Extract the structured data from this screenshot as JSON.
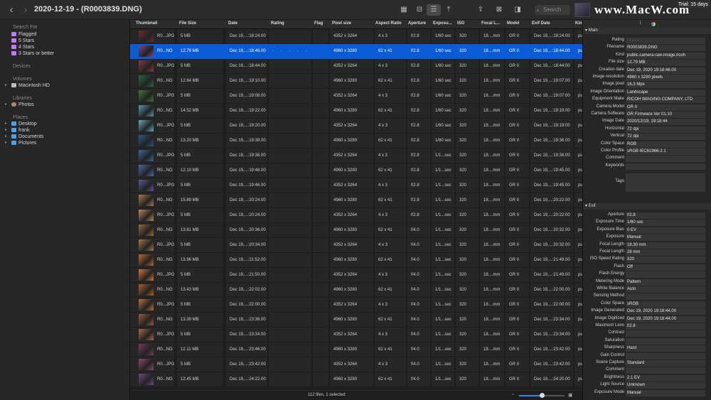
{
  "window": {
    "title": "2020-12-19 - (R0003839.DNG)",
    "trial_badge": "Trial: 15 days",
    "watermark": "www.MacW.com",
    "search_placeholder": "Search"
  },
  "toolbar": {
    "buttons": [
      "grid-view-icon",
      "split-view-icon",
      "list-view-icon",
      "export-icon",
      "share-icon",
      "trash-icon",
      "tag-icon"
    ]
  },
  "sidebar": {
    "search_for_header": "Search For",
    "search_items": [
      {
        "label": "Flagged",
        "icon": "folder-icon"
      },
      {
        "label": "5 Stars",
        "icon": "folder-icon"
      },
      {
        "label": "4 Stars",
        "icon": "folder-icon"
      },
      {
        "label": "3 Stars or better",
        "icon": "folder-icon"
      }
    ],
    "devices_header": "Devices",
    "volumes_header": "Volumes",
    "volumes": [
      {
        "label": "Macintosh HD",
        "icon": "disk-icon"
      }
    ],
    "libraries_header": "Libraries",
    "libraries": [
      {
        "label": "Photos",
        "icon": "photos-icon"
      }
    ],
    "places_header": "Places",
    "places": [
      {
        "label": "Desktop",
        "icon": "folder-icon"
      },
      {
        "label": "frank",
        "icon": "folder-icon"
      },
      {
        "label": "Documents",
        "icon": "folder-icon"
      },
      {
        "label": "Pictures",
        "icon": "folder-icon"
      }
    ]
  },
  "table": {
    "columns": [
      "Thumbnail",
      "File Size",
      "Date",
      "Rating",
      "Flag",
      "Pixel size",
      "Aspect Ratio",
      "Aperture",
      "Exposu...",
      "ISO",
      "Focal L...",
      "Model",
      "Exif Date",
      "Kin"
    ],
    "rows": [
      {
        "name": "R0...JPG",
        "size": "5 MB",
        "date": "Dec 19,...:18:24.00",
        "rating": "",
        "pixel": "4352 x 3264",
        "aspect": "4 x 3",
        "ap": "f/2.8",
        "exp": "1/60 sec",
        "iso": "320",
        "focal": "18....mm",
        "model": "GR II",
        "exif": "Dec 19,...:18:24:00",
        "kind": "pu",
        "thumb": "#6b2e2e"
      },
      {
        "name": "R0...NG",
        "size": "12.79 MB",
        "date": "Dec 19,...:18:46.00",
        "rating": "· · · · ·",
        "pixel": "4960 x 3280",
        "aspect": "62 x 41",
        "ap": "f/2.8",
        "exp": "1/60 sec",
        "iso": "320",
        "focal": "18....mm",
        "model": "GR II",
        "exif": "Dec 19,...:18:44.00",
        "kind": "pu",
        "thumb": "#7a4a8a"
      },
      {
        "name": "R0...JPG",
        "size": "5 MB",
        "date": "Dec 19,...:18:44.00",
        "rating": "",
        "pixel": "4352 x 3264",
        "aspect": "4 x 3",
        "ap": "f/2.8",
        "exp": "1/60 sec",
        "iso": "320",
        "focal": "18....mm",
        "model": "GR II",
        "exif": "Dec 19,...:18:44:00",
        "kind": "pu",
        "thumb": "#8a3a4a"
      },
      {
        "name": "R0...NG",
        "size": "12.64 MB",
        "date": "Dec 19,...:19:10.00",
        "rating": "",
        "pixel": "4960 x 3280",
        "aspect": "62 x 41",
        "ap": "f/2.8",
        "exp": "1/60 sec",
        "iso": "320",
        "focal": "18....mm",
        "model": "GR II",
        "exif": "Dec 19,...:19:07.00",
        "kind": "pu",
        "thumb": "#2a6a4a"
      },
      {
        "name": "R0...JPG",
        "size": "5 MB",
        "date": "Dec 19,...:19:08.00",
        "rating": "",
        "pixel": "4352 x 3264",
        "aspect": "4 x 3",
        "ap": "f/2.8",
        "exp": "1/60 sec",
        "iso": "320",
        "focal": "18....mm",
        "model": "GR II",
        "exif": "Dec 19,...:19:07:00",
        "kind": "pu",
        "thumb": "#3a7a3a"
      },
      {
        "name": "R0...NG",
        "size": "14.52 MB",
        "date": "Dec 19,...:19:22.00",
        "rating": "",
        "pixel": "4960 x 3280",
        "aspect": "62 x 41",
        "ap": "f/2.8",
        "exp": "1/60 sec",
        "iso": "320",
        "focal": "18....mm",
        "model": "GR II",
        "exif": "Dec 19,...:19:19.00",
        "kind": "pu",
        "thumb": "#5a9ab0"
      },
      {
        "name": "R0...JPG",
        "size": "5 MB",
        "date": "Dec 19,...:19:20.00",
        "rating": "",
        "pixel": "4352 x 3264",
        "aspect": "4 x 3",
        "ap": "f/2.8",
        "exp": "1/60 sec",
        "iso": "320",
        "focal": "18....mm",
        "model": "GR II",
        "exif": "Dec 19,...:19:19:00",
        "kind": "pu",
        "thumb": "#6aaac0"
      },
      {
        "name": "R0...NG",
        "size": "13.20 MB",
        "date": "Dec 19,...:19:38.00",
        "rating": "",
        "pixel": "4960 x 3280",
        "aspect": "62 x 41",
        "ap": "f/2.8",
        "exp": "1/60 sec",
        "iso": "320",
        "focal": "18....mm",
        "model": "GR II",
        "exif": "Dec 19,...:19:36.00",
        "kind": "pu",
        "thumb": "#2a5a8a"
      },
      {
        "name": "R0...JPG",
        "size": "5 MB",
        "date": "Dec 19,...:19:36.00",
        "rating": "",
        "pixel": "4352 x 3264",
        "aspect": "4 x 3",
        "ap": "f/2.8",
        "exp": "1/1...sec",
        "iso": "320",
        "focal": "18....mm",
        "model": "GR II",
        "exif": "Dec 19,...:19:36:00",
        "kind": "pu",
        "thumb": "#3a6a9a"
      },
      {
        "name": "R0...NG",
        "size": "12.10 MB",
        "date": "Dec 19,...:19:48.00",
        "rating": "",
        "pixel": "4960 x 3280",
        "aspect": "62 x 41",
        "ap": "f/2.8",
        "exp": "1/1...sec",
        "iso": "320",
        "focal": "18....mm",
        "model": "GR II",
        "exif": "Dec 19,...:19:45.00",
        "kind": "pu",
        "thumb": "#4a6aaa"
      },
      {
        "name": "R0...JPG",
        "size": "5 MB",
        "date": "Dec 19,...:19:46.00",
        "rating": "",
        "pixel": "4352 x 3264",
        "aspect": "4 x 3",
        "ap": "f/2.8",
        "exp": "1/1...sec",
        "iso": "320",
        "focal": "18....mm",
        "model": "GR II",
        "exif": "Dec 19,...:19:45:00",
        "kind": "pu",
        "thumb": "#5a5a9a"
      },
      {
        "name": "R0...NG",
        "size": "15.89 MB",
        "date": "Dec 19,...:20:24.00",
        "rating": "",
        "pixel": "4960 x 3280",
        "aspect": "62 x 41",
        "ap": "f/2.8",
        "exp": "1/1...sec",
        "iso": "320",
        "focal": "18....mm",
        "model": "GR II",
        "exif": "Dec 19,...:20:22.00",
        "kind": "pu",
        "thumb": "#b07a4a"
      },
      {
        "name": "R0...JPG",
        "size": "5 MB",
        "date": "Dec 19,...:20:24.00",
        "rating": "",
        "pixel": "4352 x 3264",
        "aspect": "4 x 3",
        "ap": "f/2.8",
        "exp": "1/1...sec",
        "iso": "320",
        "focal": "18....mm",
        "model": "GR II",
        "exif": "Dec 19,...:20:22:00",
        "kind": "pu",
        "thumb": "#c08a5a"
      },
      {
        "name": "R0...NG",
        "size": "13.81 MB",
        "date": "Dec 19,...:20:36.00",
        "rating": "",
        "pixel": "4960 x 3280",
        "aspect": "62 x 41",
        "ap": "f/4.0",
        "exp": "1/1...sec",
        "iso": "320",
        "focal": "18....mm",
        "model": "GR II",
        "exif": "Dec 19,...:20:32.00",
        "kind": "pu",
        "thumb": "#9a6a3a"
      },
      {
        "name": "R0...JPG",
        "size": "5 MB",
        "date": "Dec 19,...:20:34.00",
        "rating": "",
        "pixel": "4352 x 3264",
        "aspect": "4 x 3",
        "ap": "f/4.0",
        "exp": "1/1...sec",
        "iso": "320",
        "focal": "18....mm",
        "model": "GR II",
        "exif": "Dec 19,...:20:32:00",
        "kind": "pu",
        "thumb": "#aa7a4a"
      },
      {
        "name": "R0...NG",
        "size": "13.96 MB",
        "date": "Dec 19,...:21:52.00",
        "rating": "",
        "pixel": "4960 x 3280",
        "aspect": "62 x 41",
        "ap": "f/4.0",
        "exp": "1/1...sec",
        "iso": "320",
        "focal": "18....mm",
        "model": "GR II",
        "exif": "Dec 19,...:21:49.00",
        "kind": "pu",
        "thumb": "#c06a2a"
      },
      {
        "name": "R0...JPG",
        "size": "5 MB",
        "date": "Dec 19,...:21:50.00",
        "rating": "",
        "pixel": "4352 x 3264",
        "aspect": "4 x 3",
        "ap": "f/4.0",
        "exp": "1/1...sec",
        "iso": "320",
        "focal": "18....mm",
        "model": "GR II",
        "exif": "Dec 19,...:21:49:00",
        "kind": "pu",
        "thumb": "#d07a3a"
      },
      {
        "name": "R0...NG",
        "size": "13.43 MB",
        "date": "Dec 19,...:22:02.00",
        "rating": "",
        "pixel": "4960 x 3280",
        "aspect": "62 x 41",
        "ap": "f/4.0",
        "exp": "1/1...sec",
        "iso": "320",
        "focal": "18....mm",
        "model": "GR II",
        "exif": "Dec 19,...:22:00.00",
        "kind": "pu",
        "thumb": "#b0602a"
      },
      {
        "name": "R0...JPG",
        "size": "5 MB",
        "date": "Dec 19,...:22:00.00",
        "rating": "",
        "pixel": "4352 x 3264",
        "aspect": "4 x 3",
        "ap": "f/4.0",
        "exp": "1/1...sec",
        "iso": "320",
        "focal": "18....mm",
        "model": "GR II",
        "exif": "Dec 19,...:22:00:00",
        "kind": "pu",
        "thumb": "#c0703a"
      },
      {
        "name": "R0...NG",
        "size": "13.39 MB",
        "date": "Dec 19,...:23:36.00",
        "rating": "",
        "pixel": "4960 x 3280",
        "aspect": "62 x 41",
        "ap": "f/4.0",
        "exp": "1/1...sec",
        "iso": "320",
        "focal": "18....mm",
        "model": "GR II",
        "exif": "Dec 19,...:23:34.00",
        "kind": "pu",
        "thumb": "#a05a3a"
      },
      {
        "name": "R0...JPG",
        "size": "5 MB",
        "date": "Dec 19,...:23:34.00",
        "rating": "",
        "pixel": "4352 x 3264",
        "aspect": "4 x 3",
        "ap": "f/4.0",
        "exp": "1/1...sec",
        "iso": "320",
        "focal": "18....mm",
        "model": "GR II",
        "exif": "Dec 19,...:23:34:00",
        "kind": "pu",
        "thumb": "#b06a4a"
      },
      {
        "name": "R0...NG",
        "size": "12.11 MB",
        "date": "Dec 19,...:23:46.00",
        "rating": "",
        "pixel": "4960 x 3280",
        "aspect": "62 x 41",
        "ap": "f/4.0",
        "exp": "1/1...sec",
        "iso": "320",
        "focal": "18....mm",
        "model": "GR II",
        "exif": "Dec 19,...:23:42.00",
        "kind": "pu",
        "thumb": "#7a3a5a"
      },
      {
        "name": "R0...JPG",
        "size": "5 MB",
        "date": "Dec 19,...:23:42.00",
        "rating": "",
        "pixel": "4352 x 3264",
        "aspect": "4 x 3",
        "ap": "f/4.0",
        "exp": "1/1...sec",
        "iso": "320",
        "focal": "18....mm",
        "model": "GR II",
        "exif": "Dec 19,...:23:42:00",
        "kind": "pu",
        "thumb": "#8a4a6a"
      },
      {
        "name": "R0...NG",
        "size": "12.45 MB",
        "date": "Dec 19,...:24:22.00",
        "rating": "",
        "pixel": "4960 x 3280",
        "aspect": "62 x 41",
        "ap": "f/4.0",
        "exp": "1/1...sec",
        "iso": "320",
        "focal": "18....mm",
        "model": "GR II",
        "exif": "Dec 19,...:24:20.00",
        "kind": "pu",
        "thumb": "#6a4a8a"
      }
    ],
    "selected_index": 1
  },
  "status": {
    "text": "112 files, 1 selected",
    "zoom_level": 0.5
  },
  "inspector": {
    "main_header": "Main",
    "main": [
      {
        "k": "Rating",
        "v": "· · · · ·"
      },
      {
        "k": "Filename",
        "v": "R0003839.DNG"
      },
      {
        "k": "Kind",
        "v": "public.camera-raw-image.ricoh"
      },
      {
        "k": "File size",
        "v": "12.79 MB"
      },
      {
        "k": "Creation date",
        "v": "Dec 19, 2020 19:18:46.00"
      },
      {
        "k": "Image resolution",
        "v": "4960 x 3280 pixels"
      },
      {
        "k": "Image pixel",
        "v": "16.3 Mpx"
      },
      {
        "k": "Image Orientation",
        "v": "Landscape"
      },
      {
        "k": "Equipment Make",
        "v": "RICOH IMAGING COMPANY, LTD."
      },
      {
        "k": "Camera Model",
        "v": "GR II"
      },
      {
        "k": "Camera Software",
        "v": "GR Firmware Ver 01.10"
      },
      {
        "k": "Image Date",
        "v": "2020/12/19, 19:18:44"
      },
      {
        "k": "Horizontal",
        "v": "72 dpi"
      },
      {
        "k": "Vertical",
        "v": "72 dpi"
      },
      {
        "k": "Color Space",
        "v": "RGB"
      },
      {
        "k": "Color Profile",
        "v": "sRGB IEC61966-2.1"
      },
      {
        "k": "Comment",
        "v": ""
      },
      {
        "k": "Keywords",
        "v": ""
      },
      {
        "k": "Tags",
        "v": ""
      }
    ],
    "exif_header": "Exif",
    "exif": [
      {
        "k": "Aperture",
        "v": "f/2.8"
      },
      {
        "k": "Exposure Time",
        "v": "1/60 sec"
      },
      {
        "k": "Exposure Bias",
        "v": "0 EV"
      },
      {
        "k": "Exposure",
        "v": "Manual"
      },
      {
        "k": "Focal Length",
        "v": "18.30 mm"
      },
      {
        "k": "Focal Length",
        "v": "28 mm"
      },
      {
        "k": "ISO Speed Rating",
        "v": "320"
      },
      {
        "k": "Flash",
        "v": "Off"
      },
      {
        "k": "Flash Energy",
        "v": ""
      },
      {
        "k": "Metering Mode",
        "v": "Pattern"
      },
      {
        "k": "White Balance",
        "v": "Auto"
      },
      {
        "k": "Sensing Method",
        "v": ""
      },
      {
        "k": "Color Space",
        "v": "sRGB"
      },
      {
        "k": "Image Generated",
        "v": "Dec 19, 2020 19:18:44.00"
      },
      {
        "k": "Image Digitized",
        "v": "Dec 19, 2020 19:18:44.00"
      },
      {
        "k": "Maximum Lens",
        "v": "f/2.8"
      },
      {
        "k": "Contrast",
        "v": ""
      },
      {
        "k": "Saturation",
        "v": ""
      },
      {
        "k": "Sharpness",
        "v": "Hard"
      },
      {
        "k": "Gain Control",
        "v": ""
      },
      {
        "k": "Scene Capture",
        "v": "Standard"
      },
      {
        "k": "Comment",
        "v": ""
      },
      {
        "k": "Brightness",
        "v": "2.1 EV"
      },
      {
        "k": "Light Source",
        "v": "Unknown"
      },
      {
        "k": "Exposure Mode",
        "v": "Manual"
      }
    ]
  }
}
